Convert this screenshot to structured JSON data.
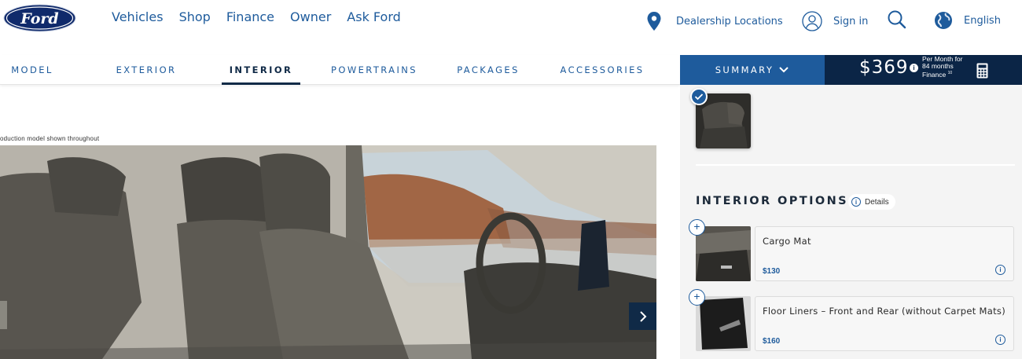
{
  "brand": {
    "logo_text": "Ford",
    "primary_color": "#1e5b9c",
    "dark_color": "#0b2546"
  },
  "nav": {
    "items": [
      {
        "label": "Vehicles"
      },
      {
        "label": "Shop"
      },
      {
        "label": "Finance"
      },
      {
        "label": "Owner"
      },
      {
        "label": "Ask Ford"
      }
    ]
  },
  "utility": {
    "dealer": {
      "label": "Dealership Locations",
      "icon": "map-pin-icon"
    },
    "signin": {
      "label": "Sign in",
      "icon": "user-icon"
    },
    "search": {
      "icon": "search-icon"
    },
    "language": {
      "label": "English",
      "icon": "globe-icon"
    }
  },
  "tabs": [
    {
      "label": "MODEL"
    },
    {
      "label": "EXTERIOR"
    },
    {
      "label": "INTERIOR",
      "active": true
    },
    {
      "label": "POWERTRAINS"
    },
    {
      "label": "PACKAGES"
    },
    {
      "label": "ACCESSORIES"
    }
  ],
  "summary": {
    "label": "SUMMARY"
  },
  "payment": {
    "amount": "$369",
    "info_mark": "i",
    "per_month": "Per Month for",
    "months": "84 months",
    "finance": "Finance",
    "finance_mark": "10"
  },
  "image": {
    "disclaimer": "oduction model shown throughout"
  },
  "panel": {
    "options_title": "INTERIOR OPTIONS",
    "details_label": "Details",
    "options": [
      {
        "name": "Cargo Mat",
        "price": "$130"
      },
      {
        "name": "Floor Liners – Front and Rear (without Carpet Mats)",
        "price": "$160"
      }
    ]
  }
}
